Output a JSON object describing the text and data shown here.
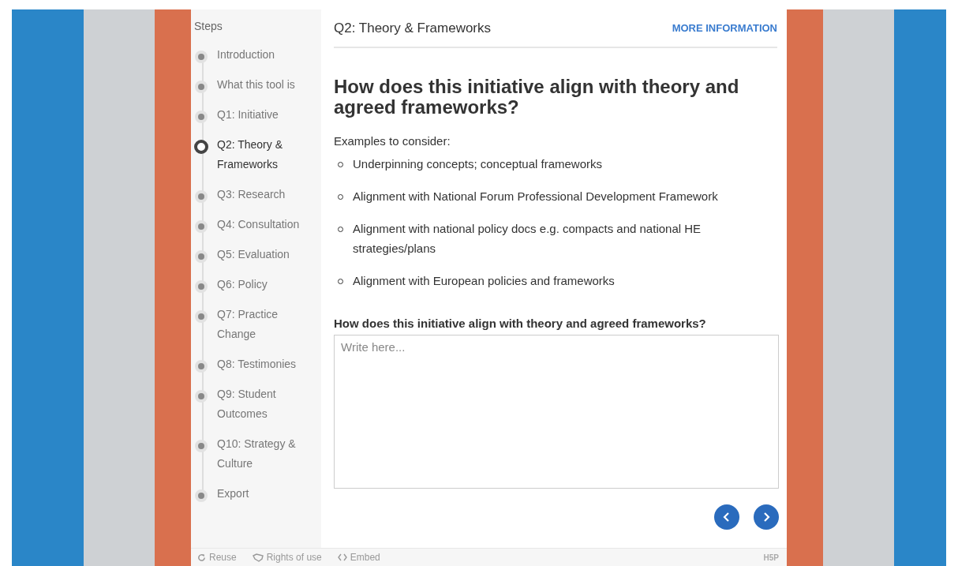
{
  "sidebar": {
    "title": "Steps",
    "steps": [
      {
        "label": "Introduction",
        "selected": false
      },
      {
        "label": "What this tool is",
        "selected": false
      },
      {
        "label": "Q1: Initiative",
        "selected": false
      },
      {
        "label": "Q2: Theory & Frameworks",
        "selected": true
      },
      {
        "label": "Q3: Research",
        "selected": false
      },
      {
        "label": "Q4: Consultation",
        "selected": false
      },
      {
        "label": "Q5: Evaluation",
        "selected": false
      },
      {
        "label": "Q6: Policy",
        "selected": false
      },
      {
        "label": "Q7: Practice Change",
        "selected": false
      },
      {
        "label": "Q8: Testimonies",
        "selected": false
      },
      {
        "label": "Q9: Student Outcomes",
        "selected": false
      },
      {
        "label": "Q10: Strategy & Culture",
        "selected": false
      },
      {
        "label": "Export",
        "selected": false
      }
    ]
  },
  "header": {
    "title": "Q2: Theory & Frameworks",
    "link": "MORE INFORMATION"
  },
  "content": {
    "heading": "How does this initiative align with theory and agreed frameworks?",
    "intro": "Examples to consider:",
    "examples": [
      "Underpinning concepts; conceptual frameworks",
      "Alignment with National Forum Professional Development Framework",
      "Alignment with national policy docs e.g. compacts and national HE strategies/plans",
      "Alignment with European policies and frameworks"
    ],
    "question": "How does this initiative align with theory and agreed frameworks?",
    "answer": {
      "placeholder": "Write here..."
    }
  },
  "footer": {
    "actions": [
      {
        "kind": "reuse",
        "label": "Reuse"
      },
      {
        "kind": "rights",
        "label": "Rights of use"
      },
      {
        "kind": "embed",
        "label": "Embed"
      }
    ],
    "logo": "H5P"
  }
}
